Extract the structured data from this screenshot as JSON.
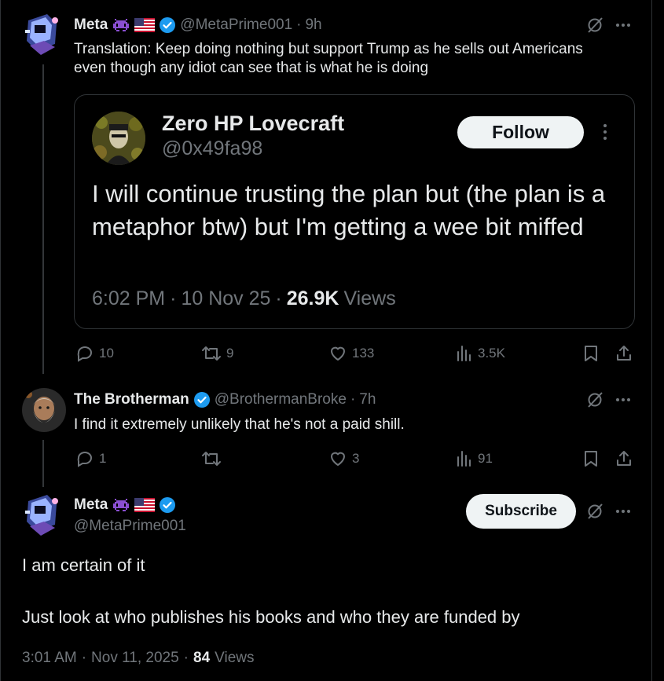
{
  "post1": {
    "name": "Meta",
    "handle": "@MetaPrime001",
    "time": "9h",
    "text": "Translation: Keep doing nothing but support Trump as he sells out Americans even though any idiot can see that is what he is doing",
    "quote": {
      "name": "Zero HP Lovecraft",
      "handle": "@0x49fa98",
      "follow_label": "Follow",
      "text": "I will continue trusting the plan but (the plan is a metaphor btw) but I'm getting a wee bit miffed",
      "time": "6:02 PM",
      "date": "10 Nov 25",
      "views_count": "26.9K",
      "views_label": "Views"
    },
    "actions": {
      "replies": "10",
      "reposts": "9",
      "likes": "133",
      "views": "3.5K"
    }
  },
  "post2": {
    "name": "The Brotherman",
    "handle": "@BrothermanBroke",
    "time": "7h",
    "text": "I find it extremely unlikely that he's not a paid shill.",
    "actions": {
      "replies": "1",
      "reposts": "",
      "likes": "3",
      "views": "91"
    }
  },
  "post3": {
    "name": "Meta",
    "handle": "@MetaPrime001",
    "subscribe_label": "Subscribe",
    "text_line1": "I am certain of it",
    "text_line2": "Just look at who publishes his books and who they are funded by",
    "time": "3:01 AM",
    "date": "Nov 11, 2025",
    "views_count": "84",
    "views_label": "Views"
  },
  "icons": {
    "verified": "verified-badge-icon",
    "flag": "us-flag-icon",
    "alien": "space-invader-icon",
    "grok": "grok-icon",
    "more": "more-dots-icon",
    "reply": "reply-icon",
    "repost": "repost-icon",
    "like": "like-icon",
    "views": "views-icon",
    "bookmark": "bookmark-icon",
    "share": "share-icon"
  },
  "colors": {
    "background": "#000000",
    "text": "#e7e9ea",
    "muted": "#71767b",
    "verified": "#1d9bf0",
    "border": "#2f3336"
  }
}
